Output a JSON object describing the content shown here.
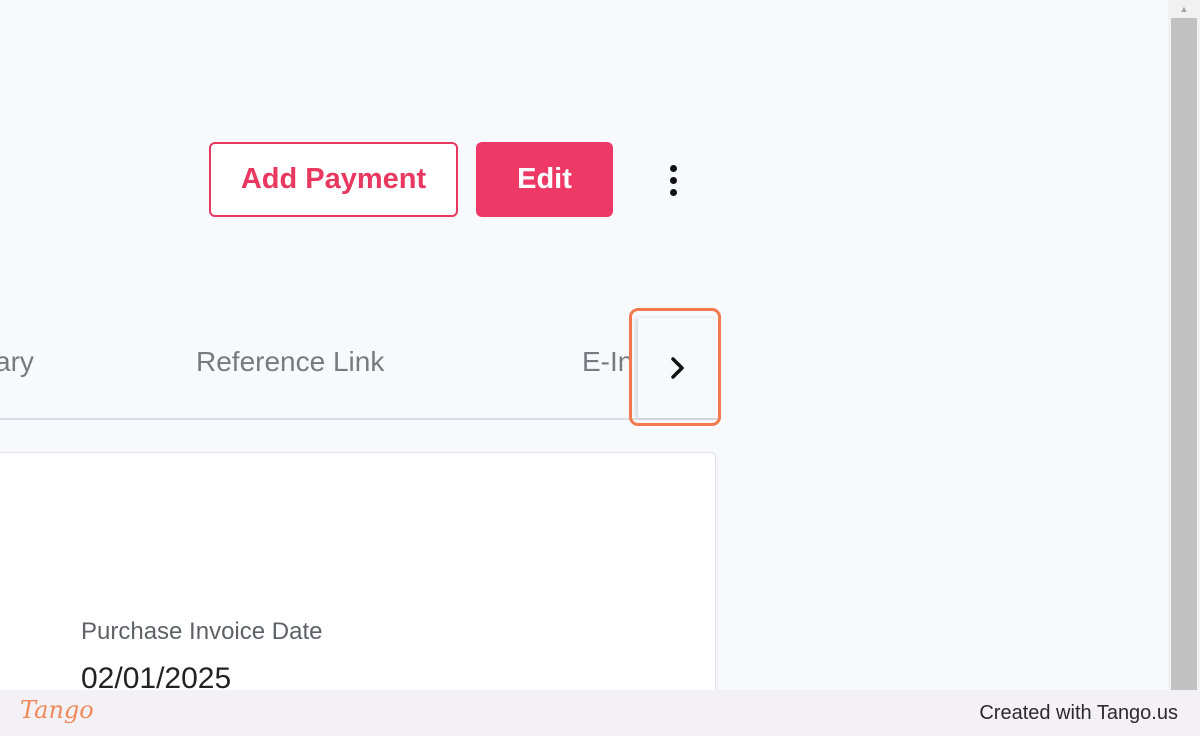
{
  "toolbar": {
    "add_payment_label": "Add Payment",
    "edit_label": "Edit",
    "more_icon": "kebab-menu-icon"
  },
  "tabs": {
    "items": [
      {
        "label": "ary"
      },
      {
        "label": "Reference Link"
      },
      {
        "label": "E-In"
      }
    ],
    "next_icon": "chevron-right-icon"
  },
  "invoice": {
    "date_label": "Purchase Invoice Date",
    "date_value": "02/01/2025"
  },
  "footer": {
    "logo_text": "Tango",
    "credit": "Created with Tango.us"
  },
  "colors": {
    "accent": "#ee3866",
    "highlight": "#f3784e",
    "background": "#f8f9fc"
  }
}
